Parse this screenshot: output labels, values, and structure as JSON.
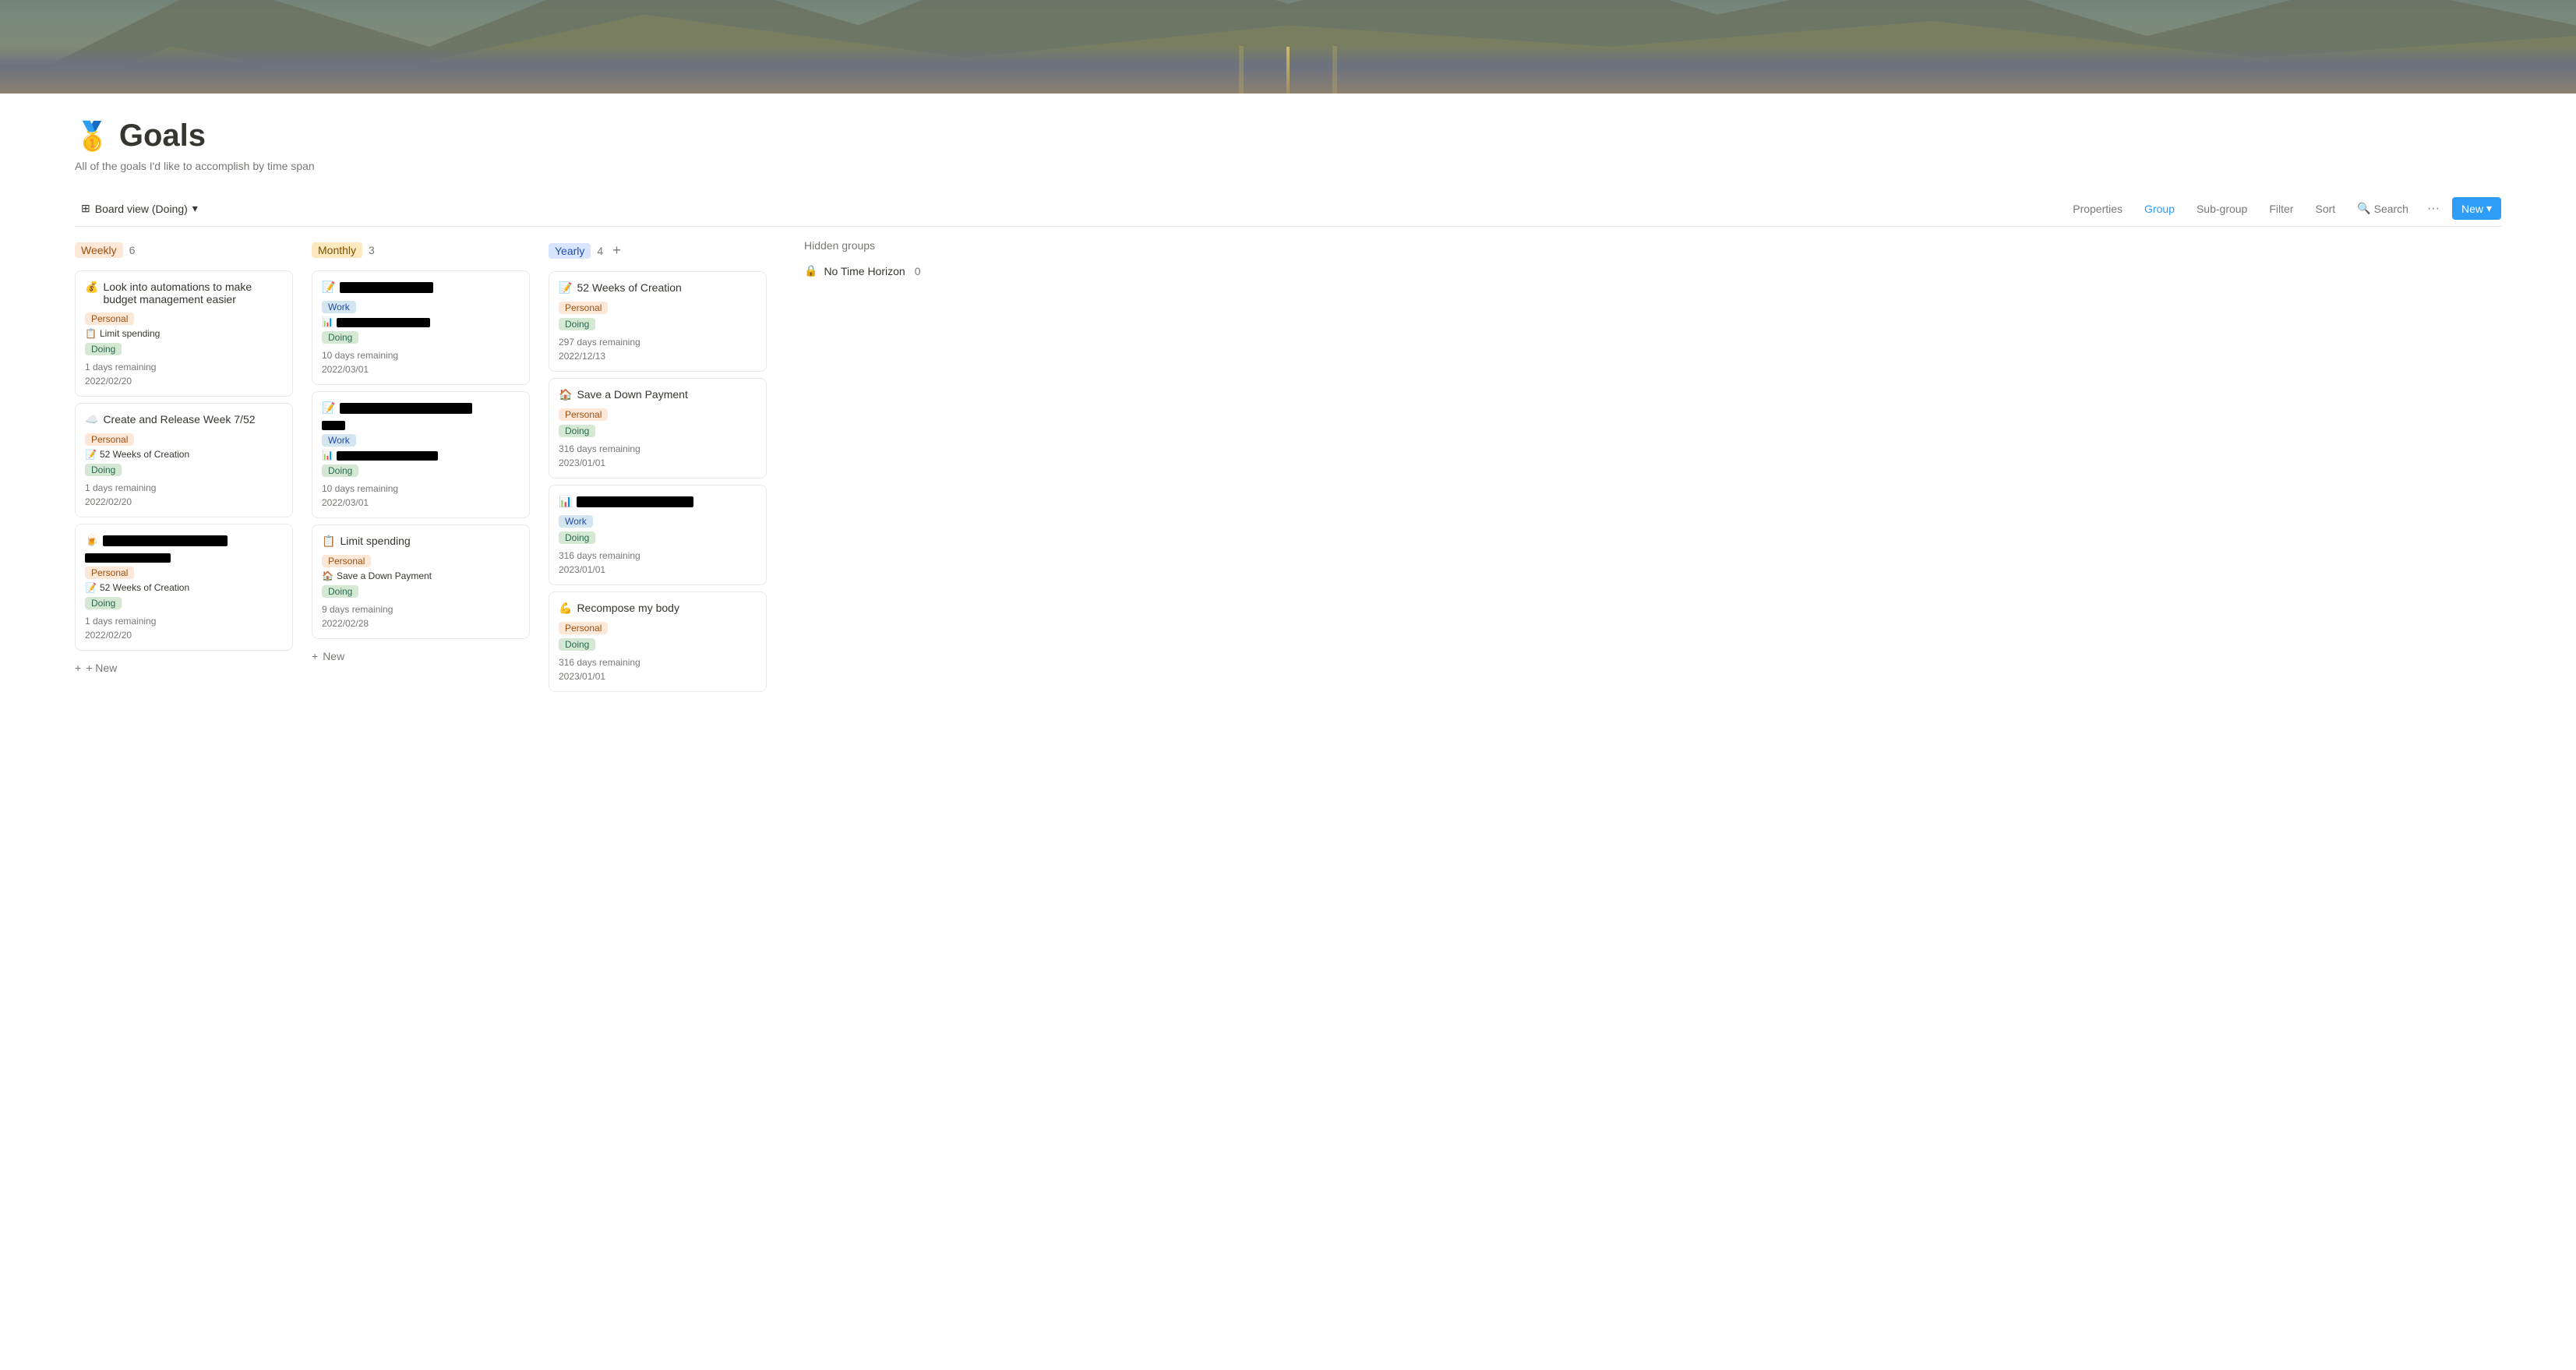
{
  "header": {
    "image_alt": "Desert road landscape"
  },
  "page": {
    "icon": "🥇",
    "title": "Goals",
    "description": "All of the goals I'd like to accomplish by time span"
  },
  "toolbar": {
    "view_label": "Board view (Doing)",
    "view_icon": "⊞",
    "properties_label": "Properties",
    "group_label": "Group",
    "subgroup_label": "Sub-group",
    "filter_label": "Filter",
    "sort_label": "Sort",
    "search_label": "Search",
    "dots_label": "···",
    "new_label": "New",
    "new_chevron": "▾"
  },
  "columns": [
    {
      "id": "weekly",
      "label": "Weekly",
      "label_class": "label-weekly",
      "count": 6,
      "cards": [
        {
          "id": "w1",
          "emoji": "💰",
          "title": "Look into automations to make budget management easier",
          "category": "Personal",
          "sub_item_emoji": "📋",
          "sub_item": "Limit spending",
          "status": "Doing",
          "days_remaining": "1 days remaining",
          "date": "2022/02/20"
        },
        {
          "id": "w2",
          "emoji": "☁️",
          "title": "Create and Release Week 7/52",
          "category": "Personal",
          "sub_item_emoji": "📝",
          "sub_item": "52 Weeks of Creation",
          "status": "Doing",
          "days_remaining": "1 days remaining",
          "date": "2022/02/20"
        },
        {
          "id": "w3",
          "emoji": "🍺",
          "title_redacted": true,
          "title_redacted_width": 160,
          "title_redacted2_width": 110,
          "category": "Personal",
          "sub_item_emoji": "📝",
          "sub_item": "52 Weeks of Creation",
          "status": "Doing",
          "days_remaining": "1 days remaining",
          "date": "2022/02/20"
        }
      ]
    },
    {
      "id": "monthly",
      "label": "Monthly",
      "label_class": "label-monthly",
      "count": 3,
      "cards": [
        {
          "id": "m1",
          "emoji": "📝",
          "title_redacted": true,
          "title_redacted_width": 120,
          "category": "Work",
          "sub_item_emoji": "📊",
          "sub_item_redacted": true,
          "sub_item_redacted_width": 120,
          "status": "Doing",
          "days_remaining": "10 days remaining",
          "date": "2022/03/01"
        },
        {
          "id": "m2",
          "emoji": "📝",
          "title_redacted": true,
          "title_redacted_width": 170,
          "title_has_extra": true,
          "category": "Work",
          "sub_item_emoji": "📊",
          "sub_item_redacted": true,
          "sub_item_redacted_width": 130,
          "status": "Doing",
          "days_remaining": "10 days remaining",
          "date": "2022/03/01"
        },
        {
          "id": "m3",
          "emoji": "📋",
          "title": "Limit spending",
          "category": "Personal",
          "sub_item_emoji": "🏠",
          "sub_item": "Save a Down Payment",
          "status": "Doing",
          "days_remaining": "9 days remaining",
          "date": "2022/02/28"
        }
      ]
    },
    {
      "id": "yearly",
      "label": "Yearly",
      "label_class": "label-yearly",
      "count": 4,
      "cards": [
        {
          "id": "y1",
          "emoji": "📝",
          "title": "52 Weeks of Creation",
          "category": "Personal",
          "status": "Doing",
          "days_remaining": "297 days remaining",
          "date": "2022/12/13"
        },
        {
          "id": "y2",
          "emoji": "🏠",
          "title": "Save a Down Payment",
          "category": "Personal",
          "status": "Doing",
          "days_remaining": "316 days remaining",
          "date": "2023/01/01"
        },
        {
          "id": "y3",
          "emoji": "📊",
          "title_redacted": true,
          "title_redacted_width": 150,
          "category": "Work",
          "status": "Doing",
          "days_remaining": "316 days remaining",
          "date": "2023/01/01"
        },
        {
          "id": "y4",
          "emoji": "💪",
          "title": "Recompose my body",
          "category": "Personal",
          "status": "Doing",
          "days_remaining": "316 days remaining",
          "date": "2023/01/01"
        }
      ]
    }
  ],
  "hidden_groups": {
    "label": "Hidden groups",
    "items": [
      {
        "emoji": "🔒",
        "label": "No Time Horizon",
        "count": 0
      }
    ]
  },
  "new_card_label": "+ New"
}
